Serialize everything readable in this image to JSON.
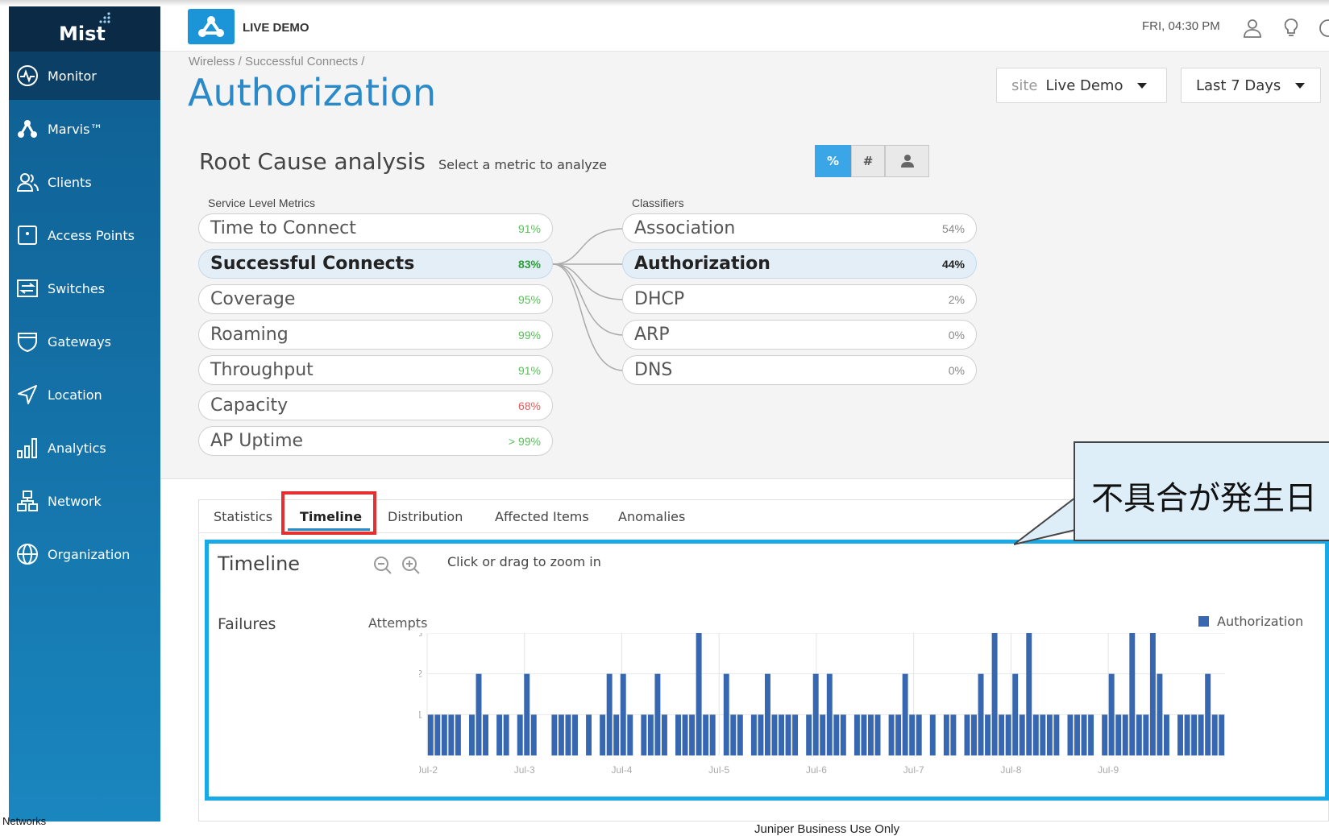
{
  "app": {
    "brand": "LIVE DEMO",
    "logo": "Mist",
    "clock": "FRI, 04:30 PM"
  },
  "sidebar": {
    "items": [
      {
        "label": "Monitor",
        "icon": "pulse-icon"
      },
      {
        "label": "Marvis™",
        "icon": "marvis-icon"
      },
      {
        "label": "Clients",
        "icon": "users-icon"
      },
      {
        "label": "Access Points",
        "icon": "access-point-icon"
      },
      {
        "label": "Switches",
        "icon": "switch-icon"
      },
      {
        "label": "Gateways",
        "icon": "shield-icon"
      },
      {
        "label": "Location",
        "icon": "location-arrow-icon"
      },
      {
        "label": "Analytics",
        "icon": "bar-chart-icon"
      },
      {
        "label": "Network",
        "icon": "network-icon"
      },
      {
        "label": "Organization",
        "icon": "globe-icon"
      }
    ],
    "footer": "Networks"
  },
  "breadcrumb": "Wireless / Successful Connects /",
  "page_title": "Authorization",
  "filters": {
    "site_prefix": "site",
    "site_value": "Live Demo",
    "range": "Last 7 Days"
  },
  "rca": {
    "title": "Root Cause analysis",
    "subtitle": "Select a metric to analyze",
    "toggles": [
      "%",
      "#"
    ],
    "service_label": "Service Level Metrics",
    "classifier_label": "Classifiers",
    "metrics": [
      {
        "name": "Time to Connect",
        "value": "91%"
      },
      {
        "name": "Successful Connects",
        "value": "83%"
      },
      {
        "name": "Coverage",
        "value": "95%"
      },
      {
        "name": "Roaming",
        "value": "99%"
      },
      {
        "name": "Throughput",
        "value": "91%"
      },
      {
        "name": "Capacity",
        "value": "68%"
      },
      {
        "name": "AP Uptime",
        "value": "> 99%"
      }
    ],
    "classifiers": [
      {
        "name": "Association",
        "value": "54%"
      },
      {
        "name": "Authorization",
        "value": "44%"
      },
      {
        "name": "DHCP",
        "value": "2%"
      },
      {
        "name": "ARP",
        "value": "0%"
      },
      {
        "name": "DNS",
        "value": "0%"
      }
    ]
  },
  "tabs": [
    "Statistics",
    "Timeline",
    "Distribution",
    "Affected Items",
    "Anomalies"
  ],
  "timeline": {
    "title": "Timeline",
    "hint": "Click or drag to zoom in",
    "failures_label": "Failures",
    "attempts_label": "Attempts",
    "legend": "Authorization"
  },
  "callout": "不具合が発生日",
  "footer_note": "Juniper Business Use Only",
  "colors": {
    "accent": "#2a8ac9",
    "bar": "#3667b0",
    "highlight_box": "#19a9e6",
    "tab_box": "#e53030"
  },
  "chart_data": {
    "type": "bar",
    "series": [
      {
        "name": "Authorization",
        "values": [
          1,
          1,
          1,
          1,
          1,
          0,
          1,
          2,
          1,
          0,
          1,
          1,
          0,
          1,
          2,
          1,
          0,
          0,
          1,
          1,
          1,
          1,
          0,
          1,
          0,
          1,
          2,
          1,
          2,
          1,
          0,
          1,
          1,
          2,
          1,
          0,
          1,
          1,
          1,
          3,
          1,
          1,
          0,
          2,
          1,
          1,
          0,
          1,
          1,
          2,
          1,
          1,
          1,
          1,
          0,
          1,
          2,
          1,
          2,
          1,
          1,
          0,
          1,
          1,
          1,
          1,
          0,
          1,
          1,
          2,
          1,
          1,
          0,
          1,
          0,
          1,
          1,
          0,
          1,
          1,
          2,
          1,
          3,
          1,
          1,
          2,
          1,
          3,
          1,
          1,
          1,
          1,
          0,
          1,
          1,
          1,
          1,
          0,
          1,
          2,
          1,
          1,
          3,
          1,
          1,
          3,
          2,
          1,
          0,
          1,
          1,
          1,
          1,
          2,
          1,
          1
        ]
      }
    ],
    "x_ticks": [
      "Jul-2",
      "Jul-3",
      "Jul-4",
      "Jul-5",
      "Jul-6",
      "Jul-7",
      "Jul-8",
      "Jul-9"
    ],
    "y_ticks": [
      "1",
      "2",
      "3"
    ],
    "ylim": [
      0,
      3
    ],
    "grid": true
  }
}
